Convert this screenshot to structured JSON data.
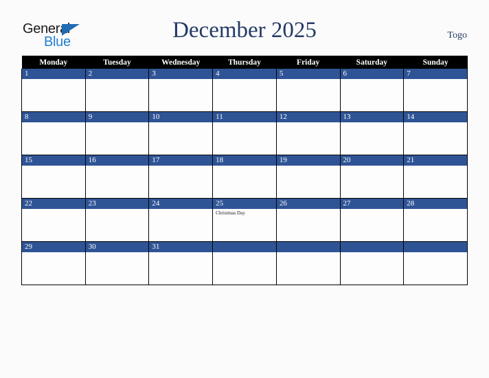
{
  "brand": {
    "name_part1": "General",
    "name_part2": "Blue",
    "triangle_color": "#1f6cb5",
    "blue_color": "#1f7fd4"
  },
  "header": {
    "title": "December 2025",
    "country": "Togo",
    "title_color": "#243a66"
  },
  "theme": {
    "header_row_bg": "#000000",
    "date_banner_bg": "#2f5496",
    "cell_bg": "#fdfdfd",
    "page_bg": "#fbfbfb",
    "grid_line": "#000000"
  },
  "weekdays": [
    "Monday",
    "Tuesday",
    "Wednesday",
    "Thursday",
    "Friday",
    "Saturday",
    "Sunday"
  ],
  "weeks": [
    {
      "days": [
        {
          "number": "1",
          "events": []
        },
        {
          "number": "2",
          "events": []
        },
        {
          "number": "3",
          "events": []
        },
        {
          "number": "4",
          "events": []
        },
        {
          "number": "5",
          "events": []
        },
        {
          "number": "6",
          "events": []
        },
        {
          "number": "7",
          "events": []
        }
      ]
    },
    {
      "days": [
        {
          "number": "8",
          "events": []
        },
        {
          "number": "9",
          "events": []
        },
        {
          "number": "10",
          "events": []
        },
        {
          "number": "11",
          "events": []
        },
        {
          "number": "12",
          "events": []
        },
        {
          "number": "13",
          "events": []
        },
        {
          "number": "14",
          "events": []
        }
      ]
    },
    {
      "days": [
        {
          "number": "15",
          "events": []
        },
        {
          "number": "16",
          "events": []
        },
        {
          "number": "17",
          "events": []
        },
        {
          "number": "18",
          "events": []
        },
        {
          "number": "19",
          "events": []
        },
        {
          "number": "20",
          "events": []
        },
        {
          "number": "21",
          "events": []
        }
      ]
    },
    {
      "days": [
        {
          "number": "22",
          "events": []
        },
        {
          "number": "23",
          "events": []
        },
        {
          "number": "24",
          "events": []
        },
        {
          "number": "25",
          "events": [
            "Christmas Day"
          ]
        },
        {
          "number": "26",
          "events": []
        },
        {
          "number": "27",
          "events": []
        },
        {
          "number": "28",
          "events": []
        }
      ]
    },
    {
      "days": [
        {
          "number": "29",
          "events": []
        },
        {
          "number": "30",
          "events": []
        },
        {
          "number": "31",
          "events": []
        },
        {
          "number": "",
          "events": []
        },
        {
          "number": "",
          "events": []
        },
        {
          "number": "",
          "events": []
        },
        {
          "number": "",
          "events": []
        }
      ]
    }
  ]
}
